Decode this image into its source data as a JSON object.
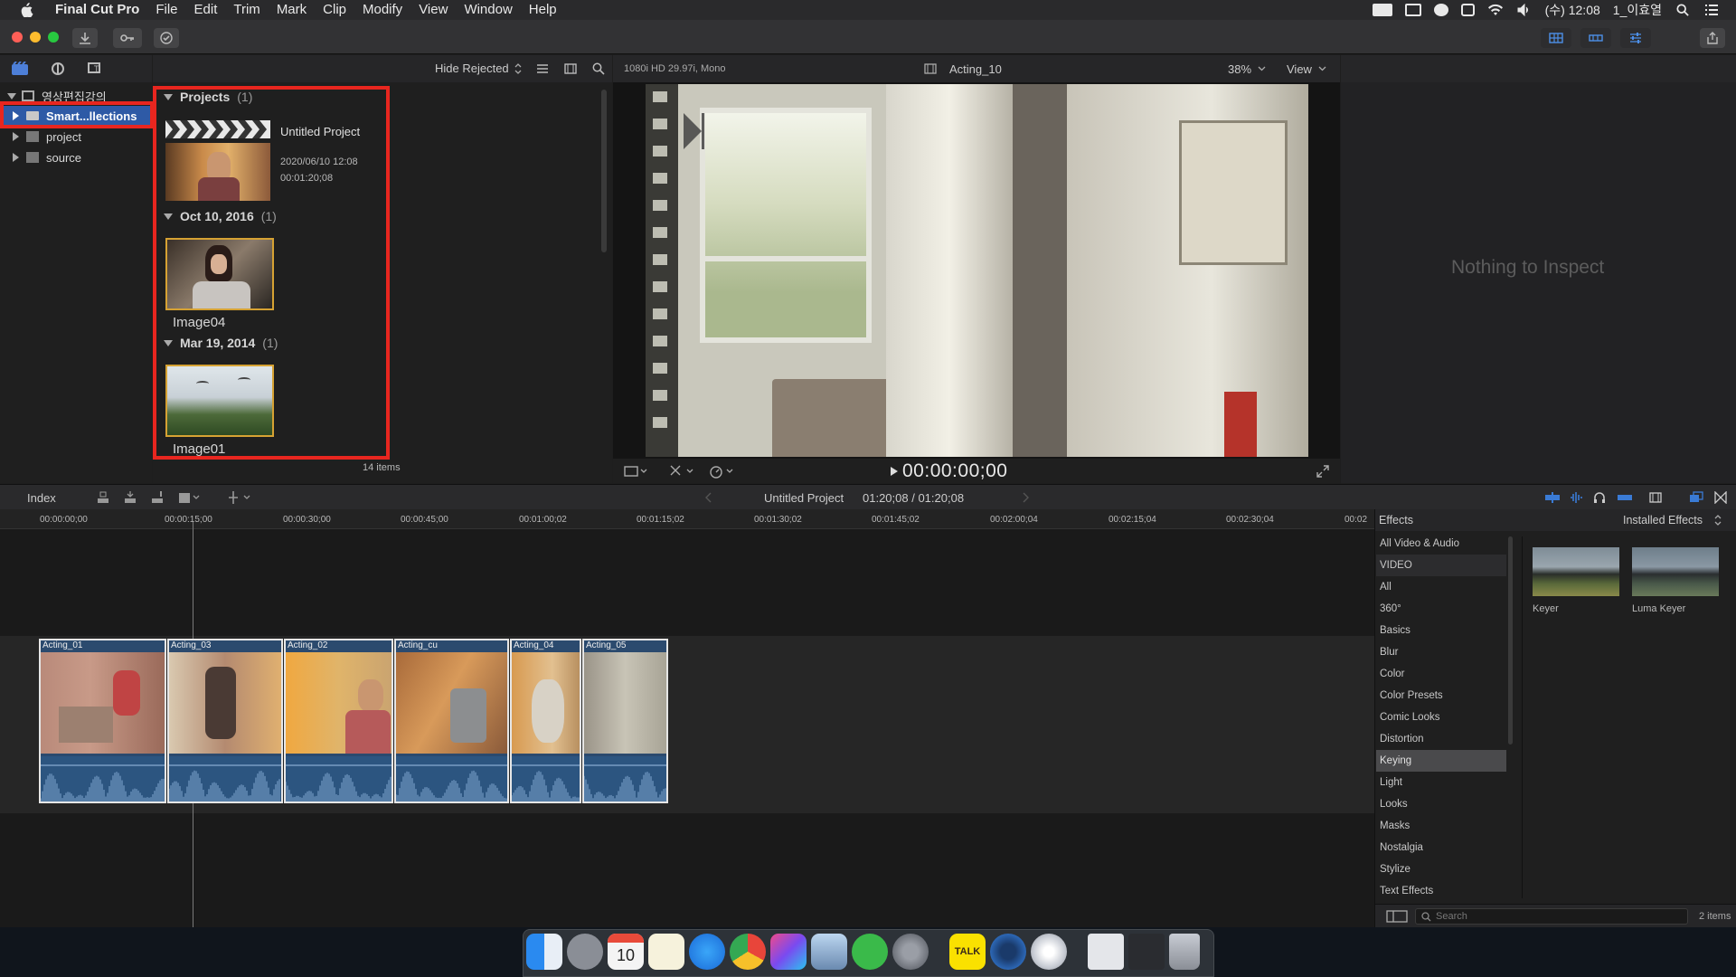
{
  "menubar": {
    "app_name": "Final Cut Pro",
    "items": [
      "File",
      "Edit",
      "Trim",
      "Mark",
      "Clip",
      "Modify",
      "View",
      "Window",
      "Help"
    ],
    "clock": "(수) 12:08",
    "user": "1_이효열"
  },
  "browser": {
    "library_name": "영상편집강의",
    "tree": [
      "Smart...llections",
      "project",
      "source"
    ],
    "filter": "Hide Rejected",
    "sections": [
      {
        "title": "Projects",
        "count": "(1)",
        "item_name": "Untitled Project",
        "item_date": "2020/06/10 12:08",
        "item_duration": "00:01:20;08"
      },
      {
        "title": "Oct 10, 2016",
        "count": "(1)",
        "item_name": "Image04"
      },
      {
        "title": "Mar 19, 2014",
        "count": "(1)",
        "item_name": "Image01"
      }
    ],
    "item_count": "14 items"
  },
  "viewer": {
    "format": "1080i HD 29.97i, Mono",
    "clip_name": "Acting_10",
    "zoom": "38%",
    "view_label": "View",
    "timecode": "00:00:00;00"
  },
  "inspector": {
    "empty_text": "Nothing to Inspect"
  },
  "timeline": {
    "index_label": "Index",
    "project_name": "Untitled Project",
    "duration": "01:20;08 / 01:20;08",
    "ruler": [
      "00:00:00;00",
      "00:00:15;00",
      "00:00:30;00",
      "00:00:45;00",
      "00:01:00;02",
      "00:01:15;02",
      "00:01:30;02",
      "00:01:45;02",
      "00:02:00;04",
      "00:02:15;04",
      "00:02:30;04",
      "00:02"
    ],
    "clips": [
      "Acting_01",
      "Acting_03",
      "Acting_02",
      "Acting_cu",
      "Acting_04",
      "Acting_05"
    ]
  },
  "effects": {
    "title": "Effects",
    "installed_label": "Installed Effects",
    "categories": [
      "All Video & Audio",
      "VIDEO",
      "All",
      "360°",
      "Basics",
      "Blur",
      "Color",
      "Color Presets",
      "Comic Looks",
      "Distortion",
      "Keying",
      "Light",
      "Looks",
      "Masks",
      "Nostalgia",
      "Stylize",
      "Text Effects"
    ],
    "selected": "Keying",
    "items": [
      "Keyer",
      "Luma Keyer"
    ],
    "search_placeholder": "Search",
    "count": "2 items"
  },
  "dock": {
    "calendar_day": "10",
    "talk_label": "TALK"
  },
  "colors": {
    "highlight_red": "#e8261f",
    "clip_blue": "#2c5580",
    "accent_blue": "#3a7bd5"
  }
}
